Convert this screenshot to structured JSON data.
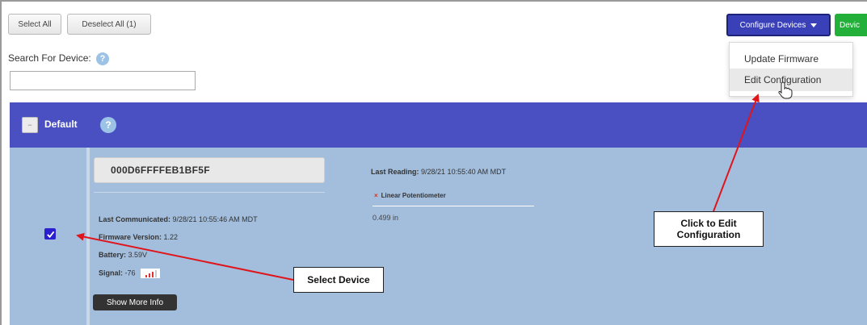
{
  "toolbar": {
    "select_all": "Select All",
    "deselect_all": "Deselect All (1)",
    "configure_devices": "Configure Devices",
    "devices_btn": "Devic"
  },
  "search": {
    "label": "Search For Device:",
    "help": "?",
    "value": ""
  },
  "dropdown": {
    "items": [
      "Update Firmware",
      "Edit Configuration"
    ]
  },
  "group": {
    "title": "Default",
    "help": "?",
    "collapse": "−"
  },
  "device": {
    "name": "000D6FFFFEB1BF5F",
    "last_communicated_label": "Last Communicated:",
    "last_communicated_value": "9/28/21 10:55:46 AM MDT",
    "firmware_label": "Firmware Version:",
    "firmware_value": "1.22",
    "battery_label": "Battery:",
    "battery_value": "3.59V",
    "signal_label": "Signal:",
    "signal_value": "-76",
    "show_more": "Show More Info",
    "selected": true,
    "last_reading_label": "Last Reading:",
    "last_reading_value": "9/28/21 10:55:40 AM MDT",
    "sensor_name": "Linear Potentiometer",
    "sensor_value": "0.499 in"
  },
  "annotations": {
    "select_device": "Select Device",
    "edit_line1": "Click to Edit",
    "edit_line2": "Configuration"
  },
  "colors": {
    "header_blue": "#4a50c2",
    "device_bg": "#a3bedc",
    "config_btn": "#3a41b8",
    "devices_btn": "#22b03a",
    "arrow_red": "#e0151b",
    "checkbox": "#2b1fd0"
  },
  "icons": {
    "help": "question-circle-icon",
    "caret": "caret-down-icon",
    "checkbox": "checkmark-icon",
    "signal": "signal-strength-icon",
    "cursor": "hand-pointer-icon"
  }
}
